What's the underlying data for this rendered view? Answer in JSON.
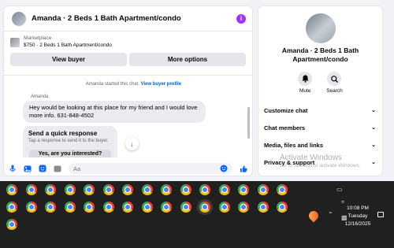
{
  "chat": {
    "title": "Amanda · 2 Beds 1 Bath Apartment/condo",
    "info_icon": "i",
    "listing": {
      "label": "Marketplace",
      "price_line": "$750 · 2 Beds 1 Bath Apartment/condo",
      "view_buyer": "View buyer",
      "more_options": "More options"
    },
    "started_text": "Amanda started this chat.",
    "view_profile": "View buyer profile",
    "sender": "Amanda",
    "message": "Hey would be looking at this place for my friend and I would love more info. 631-848-4502",
    "quick_response": {
      "title": "Send a quick response",
      "subtitle": "Tap a response to send it to the buyer.",
      "option": "Yes, are you interested?"
    },
    "composer_placeholder": "Aa"
  },
  "side": {
    "name": "Amanda · 2 Beds 1 Bath Apartment/condo",
    "actions": [
      {
        "label": "Mute",
        "icon": "bell-icon"
      },
      {
        "label": "Search",
        "icon": "search-icon"
      }
    ],
    "menu": [
      "Customize chat",
      "Chat members",
      "Media, files and links",
      "Privacy & support"
    ]
  },
  "watermark": {
    "title": "Activate Windows",
    "subtitle": "Go to Settings to activate Windows."
  },
  "taskbar": {
    "time": "10:08 PM",
    "day": "Tuesday",
    "date": "12/16/2025",
    "chrome_icon_count": 31
  },
  "colors": {
    "accent": "#0866ff",
    "info": "#a033ff",
    "taskbar": "#202020"
  }
}
